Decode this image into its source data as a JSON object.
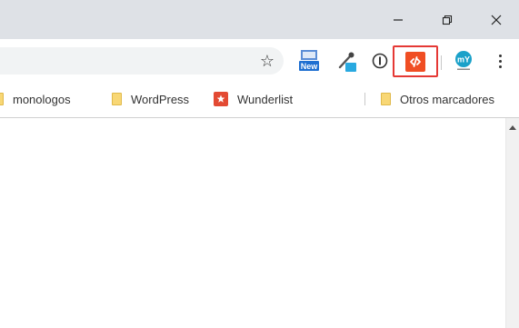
{
  "window": {
    "minimize_icon": "minimize-icon",
    "restore_icon": "restore-icon",
    "close_icon": "close-icon"
  },
  "toolbar": {
    "bookmark_star_icon": "star-icon",
    "extensions": [
      {
        "name": "new-extension",
        "badge": "New",
        "color": "#1e6fd1"
      },
      {
        "name": "eyedropper-extension",
        "color": "#29a9e0"
      },
      {
        "name": "onepassword-extension"
      },
      {
        "name": "highlighted-extension",
        "color": "#f04e23",
        "highlight_border": "#e53935"
      },
      {
        "name": "my-extension",
        "label": "mY",
        "color": "#1aa1c9"
      }
    ],
    "menu_icon": "kebab-menu-icon"
  },
  "bookmarks": {
    "items": [
      {
        "label": "monologos",
        "icon": "folder-icon"
      },
      {
        "label": "WordPress",
        "icon": "folder-icon"
      },
      {
        "label": "Wunderlist",
        "icon": "wunderlist-icon"
      }
    ],
    "other": {
      "label": "Otros marcadores",
      "icon": "folder-icon"
    }
  },
  "colors": {
    "titlebar": "#dee1e6",
    "omnibox": "#f1f3f4",
    "folder": "#f8d775"
  }
}
